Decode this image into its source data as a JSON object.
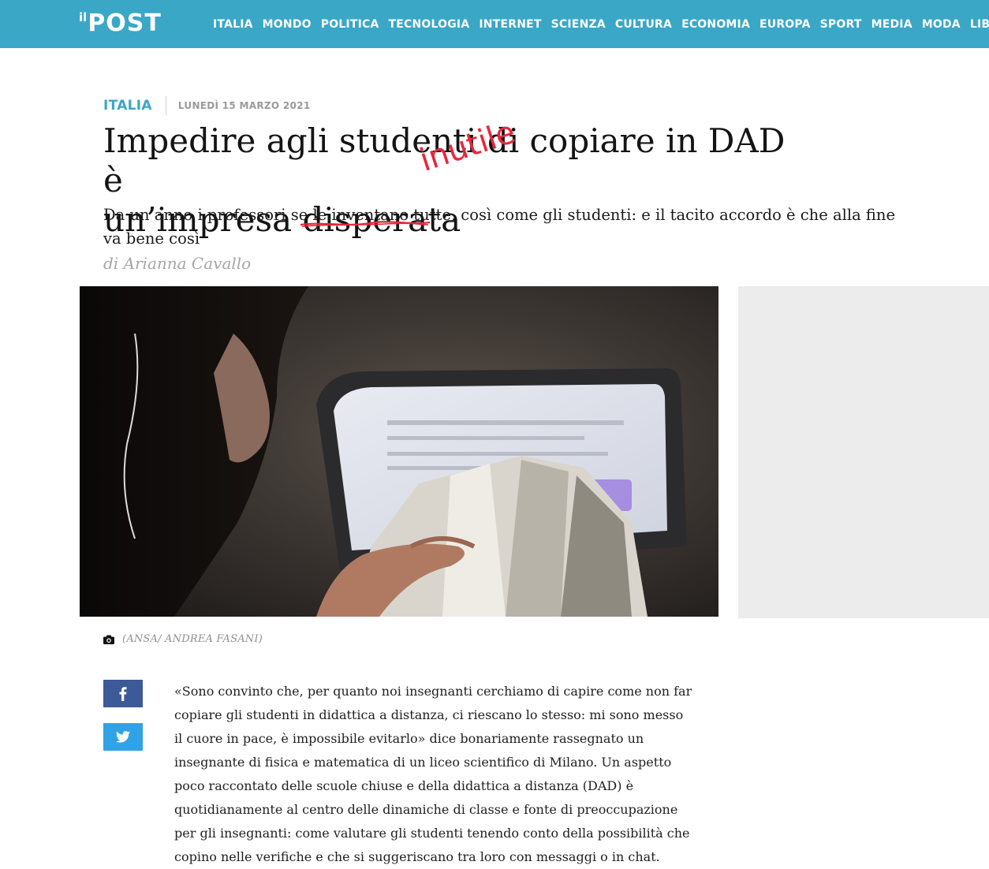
{
  "brand": {
    "prefix": "il",
    "name": "POST"
  },
  "nav": [
    "ITALIA",
    "MONDO",
    "POLITICA",
    "TECNOLOGIA",
    "INTERNET",
    "SCIENZA",
    "CULTURA",
    "ECONOMIA",
    "EUROPA",
    "SPORT",
    "MEDIA",
    "MODA",
    "LIBRI"
  ],
  "article": {
    "category": "ITALIA",
    "date": "LUNEDÌ 15 MARZO 2021",
    "title_line1": "Impedire agli studenti di copiare in DAD è",
    "title_line2_prefix": "un’impresa ",
    "title_struck": "disperata",
    "title_handwritten": "inutile",
    "subtitle": "Da un anno i professori se le inventano tutte, così come gli studenti: e il tacito accordo è che alla fine va bene così",
    "byline": "di Arianna Cavallo",
    "photo_caption": "(ANSA/ ANDREA FASANI)",
    "body": "«Sono convinto che, per quanto noi insegnanti cerchiamo di capire come non far copiare gli studenti in didattica a distanza, ci riescano lo stesso: mi sono messo il cuore in pace, è impossibile evitarlo» dice bonariamente rassegnato un insegnante di fisica e matematica di un liceo scientifico di Milano. Un aspetto poco raccontato delle scuole chiuse e della didattica a distanza (DAD) è quotidianamente al centro delle dinamiche di classe e fonte di preoccupazione per gli insegnanti: come valutare gli studenti tenendo conto della possibilità che copino nelle verifiche e che si suggeriscano tra loro con messaggi o in chat."
  },
  "share": {
    "facebook_icon": "facebook-icon",
    "twitter_icon": "twitter-icon"
  },
  "colors": {
    "brand_blue": "#3aa7c7",
    "correction_red": "#e5283a",
    "facebook": "#3d5a98",
    "twitter": "#2fa3e6"
  }
}
